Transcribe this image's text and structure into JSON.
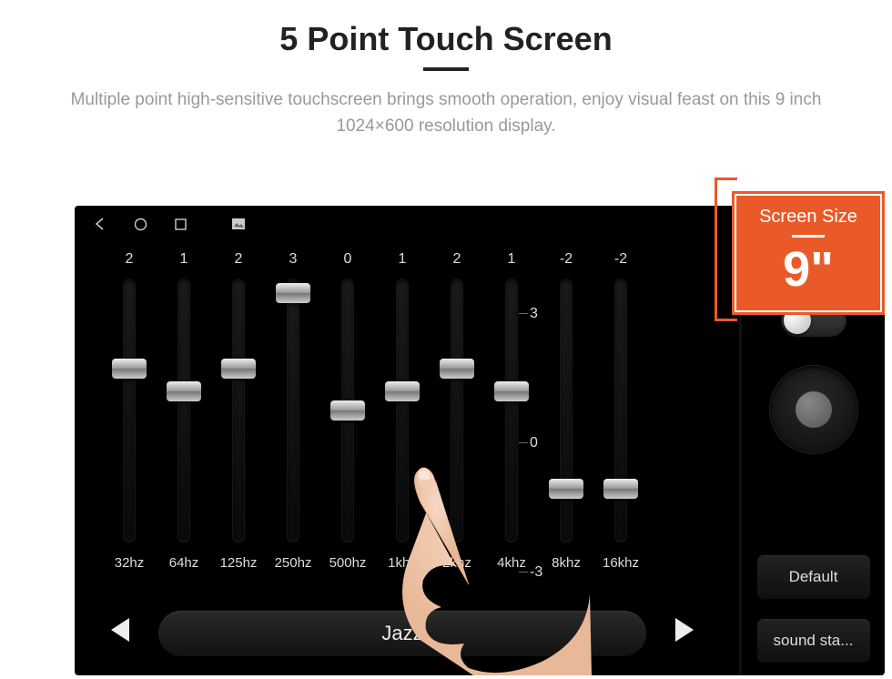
{
  "header": {
    "title": "5 Point Touch Screen",
    "subtitle": "Multiple point high-sensitive touchscreen brings smooth operation, enjoy visual feast on this 9 inch 1024×600 resolution display."
  },
  "badge": {
    "label": "Screen Size",
    "value": "9\""
  },
  "eq": {
    "bands": [
      {
        "freq": "32hz",
        "value": "2",
        "pos": 0.33
      },
      {
        "freq": "64hz",
        "value": "1",
        "pos": 0.42
      },
      {
        "freq": "125hz",
        "value": "2",
        "pos": 0.33
      },
      {
        "freq": "250hz",
        "value": "3",
        "pos": 0.02
      },
      {
        "freq": "500hz",
        "value": "0",
        "pos": 0.5
      },
      {
        "freq": "1khz",
        "value": "1",
        "pos": 0.42
      },
      {
        "freq": "2khz",
        "value": "2",
        "pos": 0.33
      },
      {
        "freq": "4khz",
        "value": "1",
        "pos": 0.42
      },
      {
        "freq": "8khz",
        "value": "-2",
        "pos": 0.82
      },
      {
        "freq": "16khz",
        "value": "-2",
        "pos": 0.82
      }
    ],
    "scale": {
      "top": "3",
      "mid": "0",
      "bot": "-3"
    },
    "preset": "Jazz"
  },
  "side": {
    "default_label": "Default",
    "sound_label": "sound sta..."
  },
  "colors": {
    "accent": "#ea5a28"
  }
}
